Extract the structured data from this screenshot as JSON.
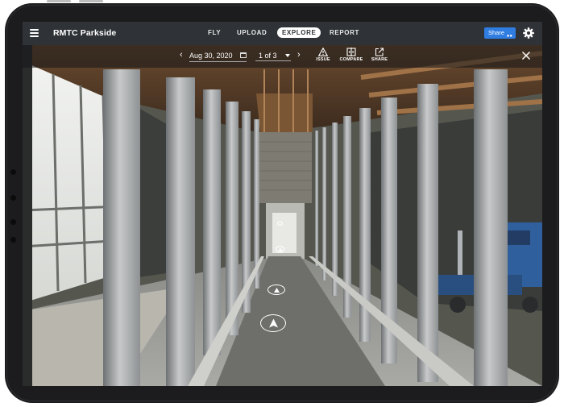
{
  "header": {
    "title": "RMTC Parkside",
    "tabs": [
      {
        "label": "FLY",
        "active": false
      },
      {
        "label": "UPLOAD",
        "active": false
      },
      {
        "label": "EXPLORE",
        "active": true
      },
      {
        "label": "REPORT",
        "active": false
      }
    ],
    "share_label": "Share",
    "share_icon": "users-icon",
    "settings_icon": "gear-icon",
    "menu_icon": "hamburger-icon"
  },
  "toolbar": {
    "date": "Aug 30, 2020",
    "page": "1 of 3",
    "tools": [
      {
        "label": "ISSUE",
        "icon": "warning-icon"
      },
      {
        "label": "COMPARE",
        "icon": "compare-icon"
      },
      {
        "label": "SHARE",
        "icon": "share-out-icon"
      }
    ],
    "close_icon": "close-icon",
    "prev_icon": "chevron-left-icon",
    "next_icon": "chevron-right-icon"
  },
  "colors": {
    "topbar": "#2f3236",
    "accent": "#2f7de1",
    "device": "#1c1c1e"
  }
}
